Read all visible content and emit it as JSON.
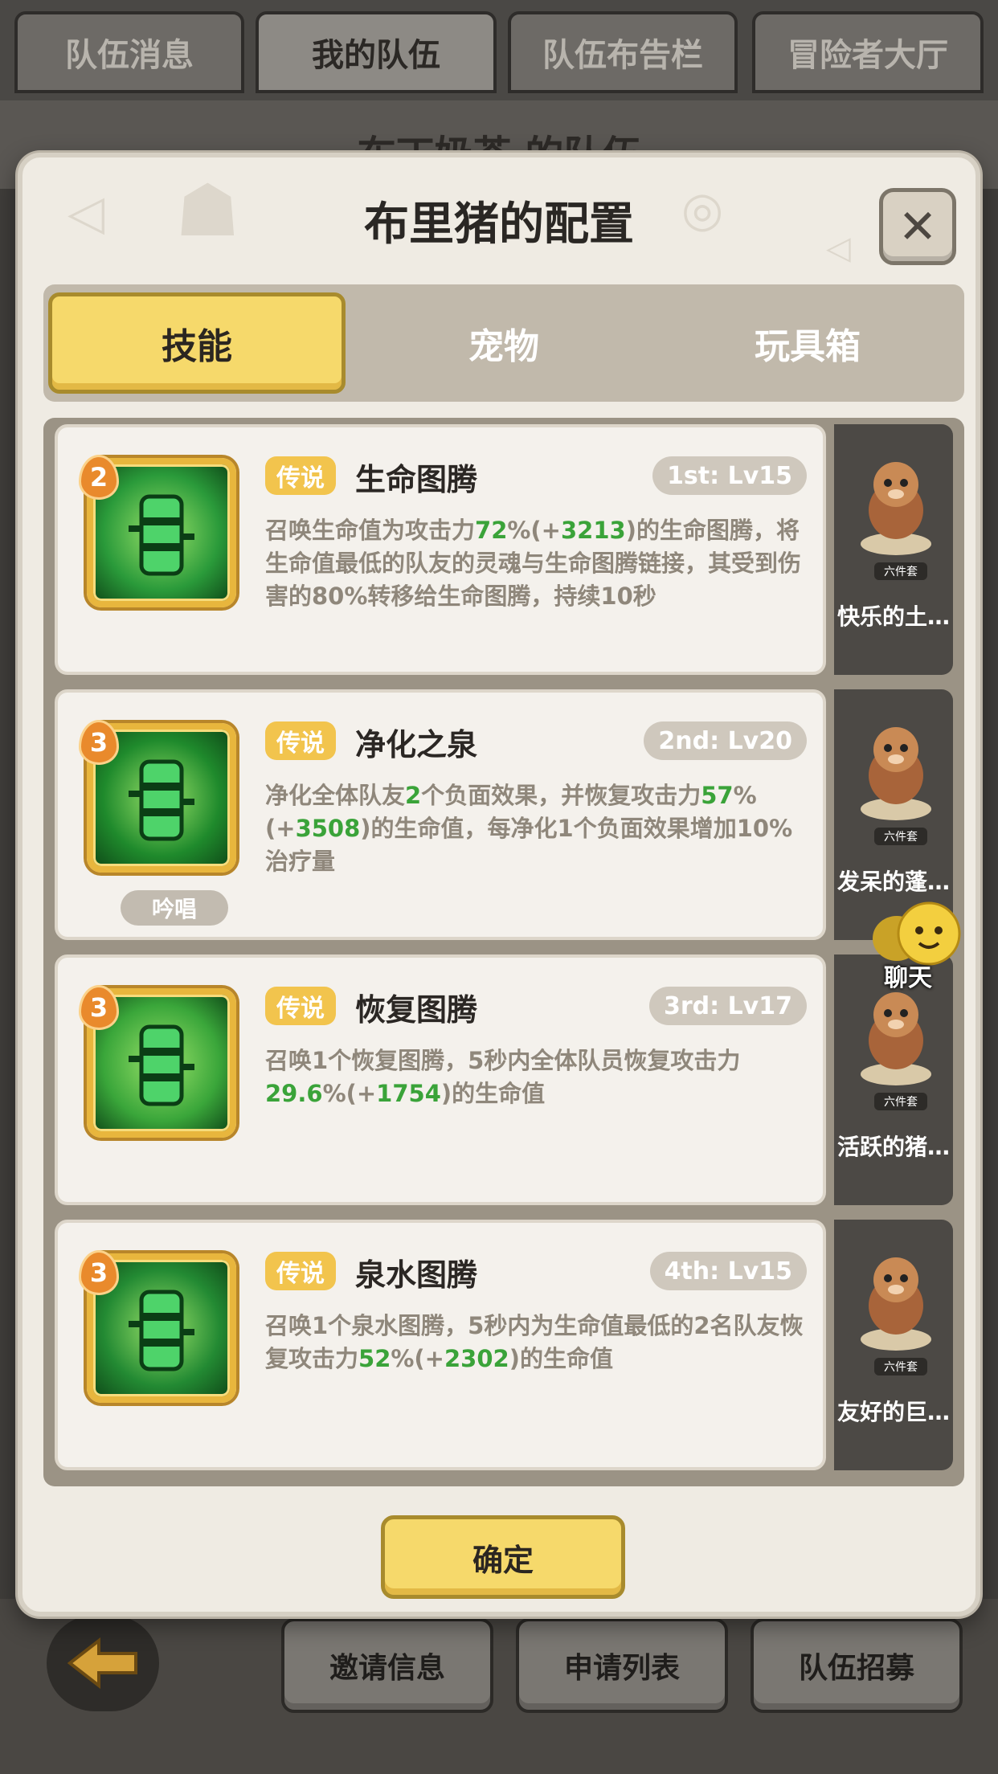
{
  "top_tabs": [
    {
      "label": "队伍消息",
      "active": false
    },
    {
      "label": "我的队伍",
      "active": true
    },
    {
      "label": "队伍布告栏",
      "active": false
    },
    {
      "label": "冒险者大厅",
      "active": false
    }
  ],
  "background_header": "布丁奶茶 的队伍",
  "modal": {
    "title": "布里猪的配置",
    "close_icon": "close-icon",
    "tabs": [
      {
        "label": "技能",
        "active": true
      },
      {
        "label": "宠物",
        "active": false
      },
      {
        "label": "玩具箱",
        "active": false
      }
    ],
    "skills": [
      {
        "level": "2",
        "rarity": "传说",
        "name": "生命图腾",
        "slot": "1st: Lv15",
        "desc_parts": [
          {
            "t": "召唤生命值为攻击力",
            "h": false
          },
          {
            "t": "72",
            "h": true
          },
          {
            "t": "%(+",
            "h": false
          },
          {
            "t": "3213",
            "h": true
          },
          {
            "t": ")的生命图腾，将生命值最低的队友的灵魂与生命图腾链接，其受到伤害的80%转移给生命图腾，持续10秒",
            "h": false
          }
        ],
        "chant": "",
        "icon_color": "#2a9a3a",
        "pet": {
          "tag": "六件套",
          "name": "快乐的土…"
        }
      },
      {
        "level": "3",
        "rarity": "传说",
        "name": "净化之泉",
        "slot": "2nd: Lv20",
        "desc_parts": [
          {
            "t": "净化全体队友",
            "h": false
          },
          {
            "t": "2",
            "h": true
          },
          {
            "t": "个负面效果，并恢复攻击力",
            "h": false
          },
          {
            "t": "57",
            "h": true
          },
          {
            "t": "%(+",
            "h": false
          },
          {
            "t": "3508",
            "h": true
          },
          {
            "t": ")的生命值，每净化1个负面效果增加10%治疗量",
            "h": false
          }
        ],
        "chant": "吟唱",
        "icon_color": "#1f8a2c",
        "pet": {
          "tag": "六件套",
          "name": "发呆的蓬…"
        }
      },
      {
        "level": "3",
        "rarity": "传说",
        "name": "恢复图腾",
        "slot": "3rd: Lv17",
        "desc_parts": [
          {
            "t": "召唤1个恢复图腾，5秒内全体队员恢复攻击力",
            "h": false
          },
          {
            "t": "29.6",
            "h": true
          },
          {
            "t": "%(+",
            "h": false
          },
          {
            "t": "1754",
            "h": true
          },
          {
            "t": ")的生命值",
            "h": false
          }
        ],
        "chant": "",
        "icon_color": "#3aa63a",
        "pet": {
          "tag": "六件套",
          "name": "活跃的猪…"
        }
      },
      {
        "level": "3",
        "rarity": "传说",
        "name": "泉水图腾",
        "slot": "4th: Lv15",
        "desc_parts": [
          {
            "t": "召唤1个泉水图腾，5秒内为生命值最低的2名队友恢复攻击力",
            "h": false
          },
          {
            "t": "52",
            "h": true
          },
          {
            "t": "%(+",
            "h": false
          },
          {
            "t": "2302",
            "h": true
          },
          {
            "t": ")的生命值",
            "h": false
          }
        ],
        "chant": "",
        "icon_color": "#238a33",
        "pet": {
          "tag": "六件套",
          "name": "友好的巨…"
        }
      }
    ],
    "confirm_label": "确定"
  },
  "chat": {
    "label": "聊天"
  },
  "bottom_buttons": [
    "邀请信息",
    "申请列表",
    "队伍招募"
  ],
  "colors": {
    "accent_yellow": "#f6d96b",
    "highlight_green": "#3aa339",
    "rarity_gold": "#f2c44d"
  }
}
